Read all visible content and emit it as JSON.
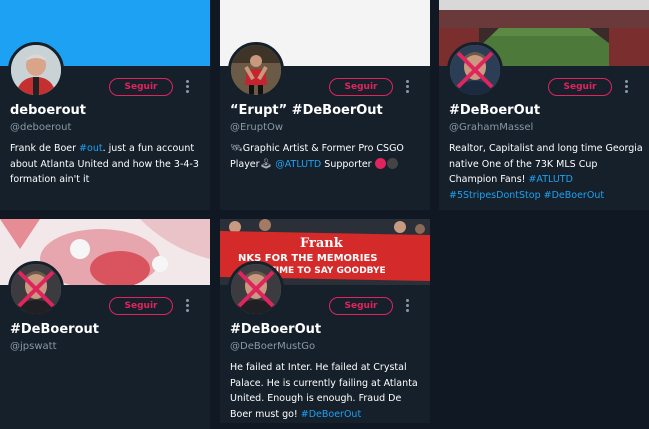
{
  "colors": {
    "background": "#0f1823",
    "card": "#15202b",
    "accent_pink": "#e0245e",
    "link_blue": "#1da1f2"
  },
  "follow_label": "Seguir",
  "cards": [
    {
      "name": "deboerout",
      "handle": "@deboerout",
      "bio": [
        {
          "text": "Frank de Boer "
        },
        {
          "text": "#out",
          "link": true
        },
        {
          "text": ". just a fun account about Atlanta United and how the 3-4-3 formation ain't it"
        }
      ]
    },
    {
      "name": "“Erupt” #DeBoerOut",
      "handle": "@EruptOw",
      "bio": [
        {
          "text": "Graphic Artist & Former Pro CSGO Player"
        },
        {
          "text": "@ATLUTD",
          "link": true
        },
        {
          "text": " Supporter"
        }
      ]
    },
    {
      "name": "#DeBoerOut",
      "handle": "@GrahamMassel",
      "bio": [
        {
          "text": "Realtor, Capitalist and long time Georgia native One of the 73K MLS Cup Champion Fans! "
        },
        {
          "text": "#ATLUTD",
          "link": true
        },
        {
          "text": " "
        },
        {
          "text": "#5StripesDontStop",
          "link": true
        },
        {
          "text": " "
        },
        {
          "text": "#DeBoerOut",
          "link": true
        }
      ]
    },
    {
      "name": "#DeBoerout",
      "handle": "@jpswatt",
      "bio": []
    },
    {
      "name": "#DeBoerOut",
      "handle": "@DeBoerMustGo",
      "banner_lines": [
        "Frank",
        "NKS FOR THE MEMORIES",
        "S TIME TO SAY GOODBYE"
      ],
      "bio": [
        {
          "text": "He failed at Inter. He failed at Crystal Palace. He is currently failing at Atlanta United. Enough is enough. Fraud De Boer must go! "
        },
        {
          "text": "#DeBoerOut",
          "link": true
        }
      ]
    }
  ]
}
